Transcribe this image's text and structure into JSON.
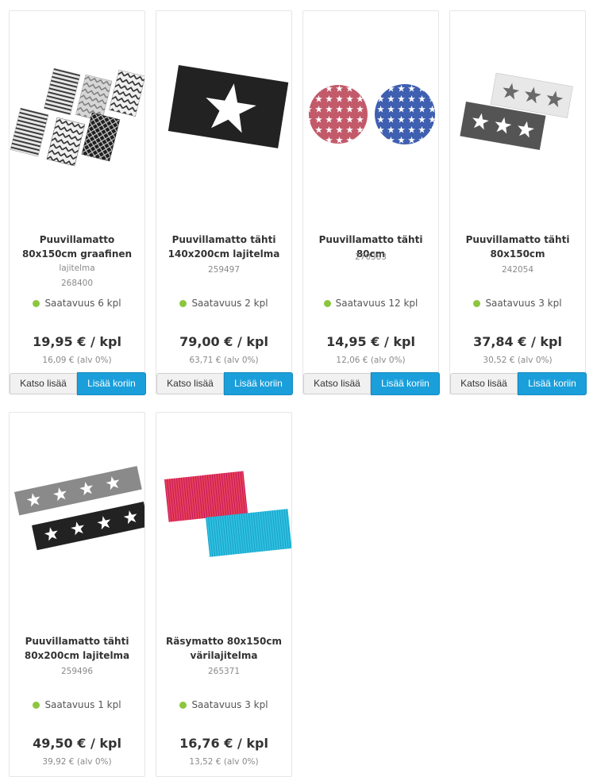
{
  "products": [
    {
      "title": "Puuvillamatto 80x150cm graafinen",
      "variant": "lajitelma",
      "code": "268400",
      "availability": "Saatavuus 6 kpl",
      "price": "19,95 € / kpl",
      "price_vat0": "16,09 € (alv 0%)",
      "more_label": "Katso lisää",
      "cart_label": "Lisää koriin",
      "image_icon": "graphic-rugs-image"
    },
    {
      "title": "Puuvillamatto tähti 140x200cm lajitelma",
      "code": "259497",
      "availability": "Saatavuus 2 kpl",
      "price": "79,00 € / kpl",
      "price_vat0": "63,71 € (alv 0%)",
      "more_label": "Katso lisää",
      "cart_label": "Lisää koriin",
      "image_icon": "star-rug-image"
    },
    {
      "title": "Puuvillamatto tähti 80cm",
      "code": "270383",
      "availability": "Saatavuus 12 kpl",
      "price": "14,95 € / kpl",
      "price_vat0": "12,06 € (alv 0%)",
      "more_label": "Katso lisää",
      "cart_label": "Lisää koriin",
      "image_icon": "round-star-rugs-image"
    },
    {
      "title": "Puuvillamatto tähti 80x150cm",
      "code": "242054",
      "availability": "Saatavuus 3 kpl",
      "price": "37,84 € / kpl",
      "price_vat0": "30,52 € (alv 0%)",
      "more_label": "Katso lisää",
      "cart_label": "Lisää koriin",
      "image_icon": "three-star-rugs-image"
    },
    {
      "title": "Puuvillamatto tähti 80x200cm lajitelma",
      "code": "259496",
      "availability": "Saatavuus 1 kpl",
      "price": "49,50 € / kpl",
      "price_vat0": "39,92 € (alv 0%)",
      "image_icon": "runner-star-rugs-image"
    },
    {
      "title": "Räsymatto 80x150cm värilajitelma",
      "code": "265371",
      "availability": "Saatavuus 3 kpl",
      "price": "16,76 € / kpl",
      "price_vat0": "13,52 € (alv 0%)",
      "image_icon": "rag-rugs-image"
    }
  ],
  "colors": {
    "cart_button": "#1a9fdb",
    "availability_dot": "#8cc63f"
  }
}
